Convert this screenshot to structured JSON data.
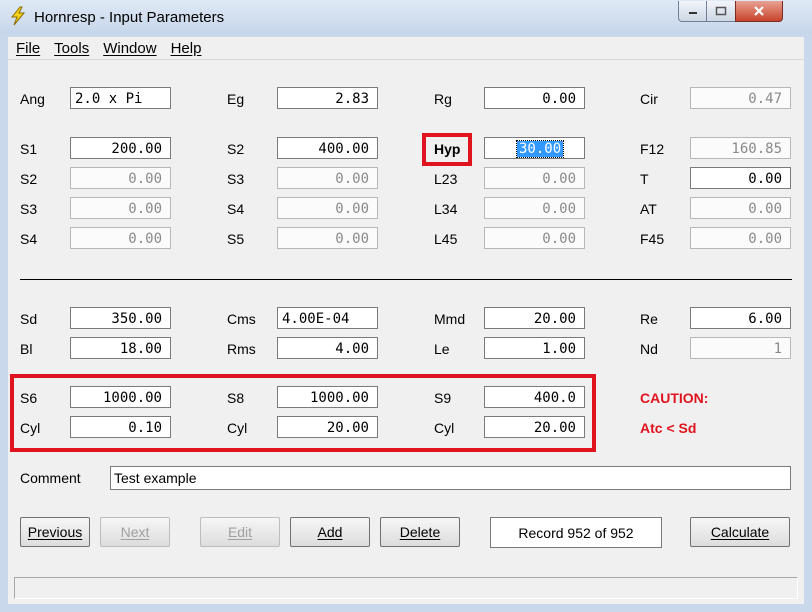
{
  "window": {
    "title": "Hornresp - Input Parameters",
    "icon": "lightning-bolt-icon"
  },
  "menu": [
    "File",
    "Tools",
    "Window",
    "Help"
  ],
  "params": {
    "ang": {
      "label": "Ang",
      "value": "2.0 x Pi"
    },
    "eg": {
      "label": "Eg",
      "value": "2.83"
    },
    "rg": {
      "label": "Rg",
      "value": "0.00"
    },
    "cir": {
      "label": "Cir",
      "value": "0.47"
    },
    "s1": {
      "label": "S1",
      "value": "200.00"
    },
    "s2a": {
      "label": "S2",
      "value": "400.00"
    },
    "hyp": {
      "label": "Hyp",
      "value": "30.00"
    },
    "f12": {
      "label": "F12",
      "value": "160.85"
    },
    "s2b": {
      "label": "S2",
      "value": "0.00"
    },
    "s3a": {
      "label": "S3",
      "value": "0.00"
    },
    "l23": {
      "label": "L23",
      "value": "0.00"
    },
    "t": {
      "label": "T",
      "value": "0.00"
    },
    "s3b": {
      "label": "S3",
      "value": "0.00"
    },
    "s4a": {
      "label": "S4",
      "value": "0.00"
    },
    "l34": {
      "label": "L34",
      "value": "0.00"
    },
    "at": {
      "label": "AT",
      "value": "0.00"
    },
    "s4b": {
      "label": "S4",
      "value": "0.00"
    },
    "s5": {
      "label": "S5",
      "value": "0.00"
    },
    "l45": {
      "label": "L45",
      "value": "0.00"
    },
    "f45": {
      "label": "F45",
      "value": "0.00"
    },
    "sd": {
      "label": "Sd",
      "value": "350.00"
    },
    "cms": {
      "label": "Cms",
      "value": "4.00E-04"
    },
    "mmd": {
      "label": "Mmd",
      "value": "20.00"
    },
    "re": {
      "label": "Re",
      "value": "6.00"
    },
    "bl": {
      "label": "Bl",
      "value": "18.00"
    },
    "rms": {
      "label": "Rms",
      "value": "4.00"
    },
    "le": {
      "label": "Le",
      "value": "1.00"
    },
    "nd": {
      "label": "Nd",
      "value": "1"
    },
    "s6": {
      "label": "S6",
      "value": "1000.00"
    },
    "s8": {
      "label": "S8",
      "value": "1000.00"
    },
    "s9": {
      "label": "S9",
      "value": "400.0"
    },
    "cyl1": {
      "label": "Cyl",
      "value": "0.10"
    },
    "cyl2": {
      "label": "Cyl",
      "value": "20.00"
    },
    "cyl3": {
      "label": "Cyl",
      "value": "20.00"
    }
  },
  "caution": {
    "line1": "CAUTION:",
    "line2": "Atc < Sd"
  },
  "comment": {
    "label": "Comment",
    "value": "Test example"
  },
  "buttons": {
    "previous": "Previous",
    "next": "Next",
    "edit": "Edit",
    "add": "Add",
    "delete": "Delete",
    "calculate": "Calculate"
  },
  "record": "Record 952 of 952",
  "colors": {
    "highlight": "#e0141e",
    "selection": "#3399ff",
    "caution": "#e0141e"
  }
}
